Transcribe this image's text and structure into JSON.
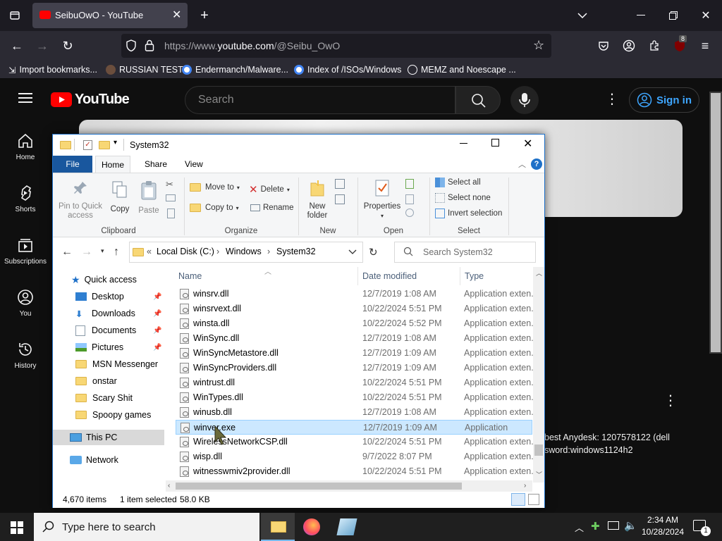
{
  "browser": {
    "tab_title": "SeibuOwO - YouTube",
    "url_prefix": "https://www.",
    "url_host": "youtube.com",
    "url_path": "/@Seibu_OwO",
    "extension_badge": "8",
    "bookmarks": [
      {
        "label": "Import bookmarks...",
        "icon": "import-icon"
      },
      {
        "label": "RUSSIAN TEST",
        "icon": "site-icon"
      },
      {
        "label": "Endermanch/Malware...",
        "icon": "google-icon"
      },
      {
        "label": "Index of /ISOs/Windows",
        "icon": "google-icon"
      },
      {
        "label": "MEMZ and Noescape ...",
        "icon": "globe-icon"
      }
    ]
  },
  "youtube": {
    "logo_text": "YouTube",
    "search_placeholder": "Search",
    "sign_in": "Sign in",
    "sidebar": [
      {
        "label": "Home",
        "icon": "home-icon"
      },
      {
        "label": "Shorts",
        "icon": "shorts-icon"
      },
      {
        "label": "Subscriptions",
        "icon": "subscriptions-icon"
      },
      {
        "label": "You",
        "icon": "you-icon"
      },
      {
        "label": "History",
        "icon": "history-icon"
      }
    ],
    "description_line1": "best Anydesk: 1207578122 (dell",
    "description_line2": "sword:windows1124h2"
  },
  "explorer": {
    "title": "System32",
    "tabs": [
      "File",
      "Home",
      "Share",
      "View"
    ],
    "ribbon": {
      "pin": "Pin to Quick access",
      "copy": "Copy",
      "paste": "Paste",
      "move_to": "Move to",
      "copy_to": "Copy to",
      "delete": "Delete",
      "rename": "Rename",
      "new_folder": "New folder",
      "properties": "Properties",
      "select_all": "Select all",
      "select_none": "Select none",
      "invert_selection": "Invert selection",
      "groups": [
        "Clipboard",
        "Organize",
        "New",
        "Open",
        "Select"
      ]
    },
    "breadcrumb": [
      "Local Disk (C:)",
      "Windows",
      "System32"
    ],
    "search_placeholder": "Search System32",
    "nav": {
      "quick_access": "Quick access",
      "items": [
        "Desktop",
        "Downloads",
        "Documents",
        "Pictures",
        "MSN Messenger",
        "onstar",
        "Scary Shit",
        "Spoopy games"
      ],
      "this_pc": "This PC",
      "network": "Network"
    },
    "columns": [
      "Name",
      "Date modified",
      "Type"
    ],
    "files": [
      {
        "name": "winsrv.dll",
        "date": "12/7/2019 1:08 AM",
        "type": "Application exten.."
      },
      {
        "name": "winsrvext.dll",
        "date": "10/22/2024 5:51 PM",
        "type": "Application exten.."
      },
      {
        "name": "winsta.dll",
        "date": "10/22/2024 5:52 PM",
        "type": "Application exten.."
      },
      {
        "name": "WinSync.dll",
        "date": "12/7/2019 1:08 AM",
        "type": "Application exten.."
      },
      {
        "name": "WinSyncMetastore.dll",
        "date": "12/7/2019 1:09 AM",
        "type": "Application exten.."
      },
      {
        "name": "WinSyncProviders.dll",
        "date": "12/7/2019 1:09 AM",
        "type": "Application exten.."
      },
      {
        "name": "wintrust.dll",
        "date": "10/22/2024 5:51 PM",
        "type": "Application exten.."
      },
      {
        "name": "WinTypes.dll",
        "date": "10/22/2024 5:51 PM",
        "type": "Application exten.."
      },
      {
        "name": "winusb.dll",
        "date": "12/7/2019 1:08 AM",
        "type": "Application exten.."
      },
      {
        "name": "winver.exe",
        "date": "12/7/2019 1:09 AM",
        "type": "Application",
        "selected": true
      },
      {
        "name": "WirelessNetworkCSP.dll",
        "date": "10/22/2024 5:51 PM",
        "type": "Application exten.."
      },
      {
        "name": "wisp.dll",
        "date": "9/7/2022 8:07 PM",
        "type": "Application exten.."
      },
      {
        "name": "witnesswmiv2provider.dll",
        "date": "10/22/2024 5:51 PM",
        "type": "Application exten.."
      }
    ],
    "status_count": "4,670 items",
    "status_selected": "1 item selected",
    "status_size": "58.0 KB"
  },
  "taskbar": {
    "search_placeholder": "Type here to search",
    "time": "2:34 AM",
    "date": "10/28/2024",
    "notification_count": "1"
  }
}
